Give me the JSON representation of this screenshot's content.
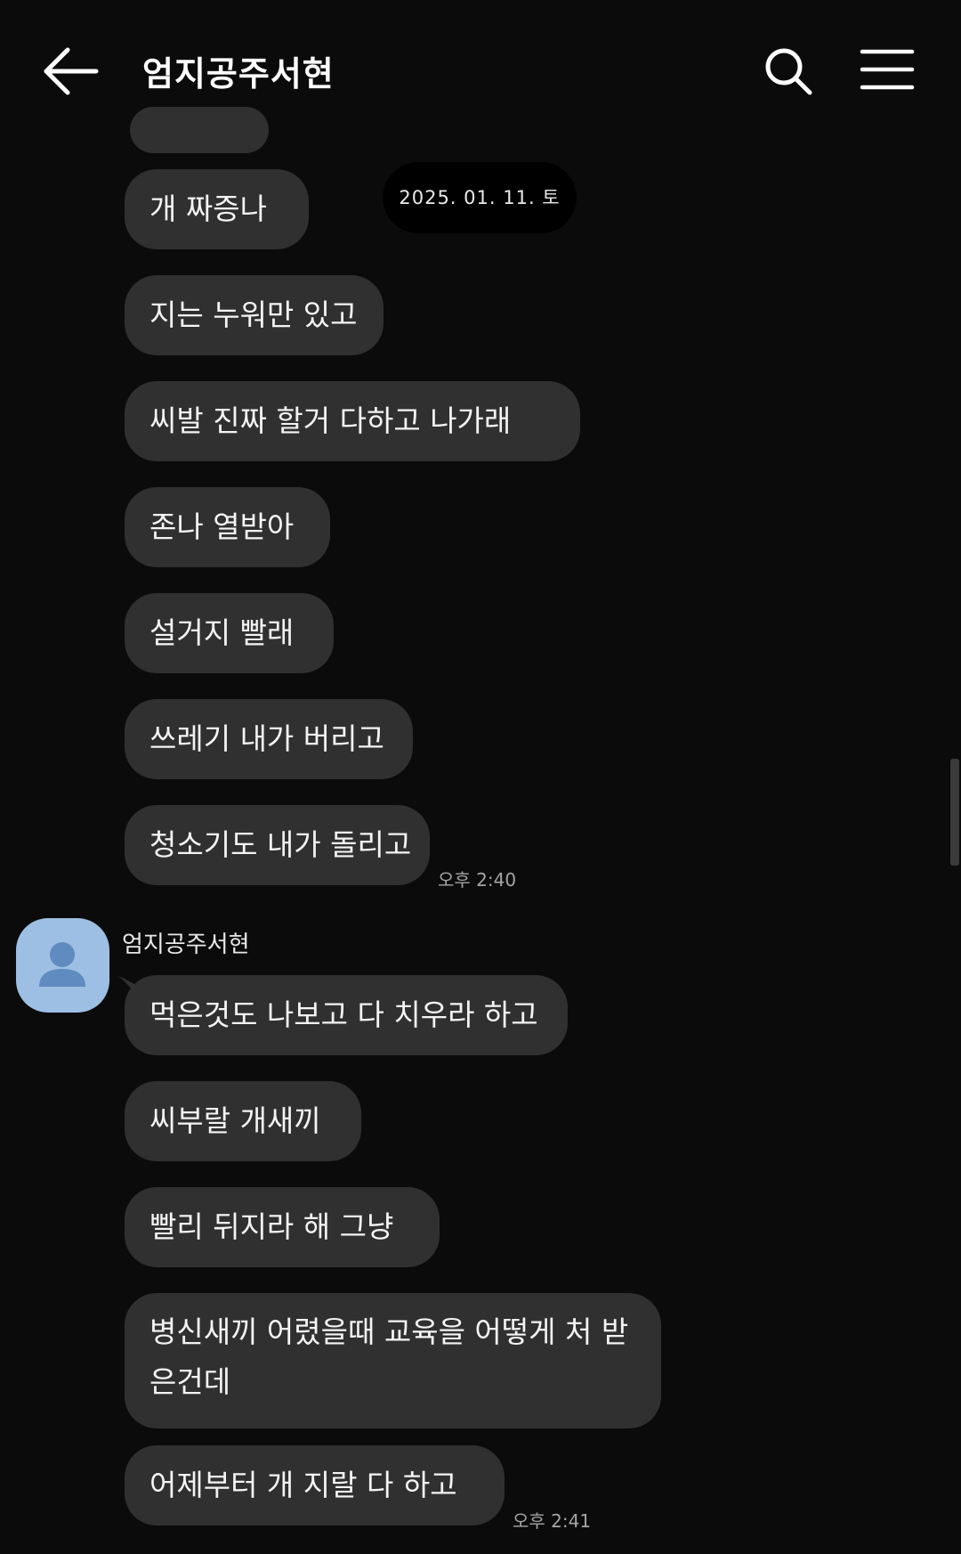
{
  "header": {
    "title": "엄지공주서현"
  },
  "date_separator": "2025. 01. 11. 토",
  "messages_group1": [
    "개 짜증나",
    "지는 누워만 있고",
    "씨발 진짜 할거 다하고 나가래",
    "존나 열받아",
    "설거지 빨래",
    "쓰레기 내가 버리고",
    "청소기도 내가 돌리고"
  ],
  "time1": "오후 2:40",
  "sender_name": "엄지공주서현",
  "messages_group2": [
    "먹은것도 나보고 다 치우라 하고",
    "씨부랄 개새끼",
    "빨리 뒤지라 해 그냥",
    "병신새끼 어렸을때 교육을 어떻게 처 받은건데",
    "어제부터 개 지랄 다 하고"
  ],
  "time2": "오후 2:41",
  "icons": [
    "back-arrow-icon",
    "search-icon",
    "menu-icon",
    "avatar-person-icon"
  ],
  "colors": {
    "background": "#0b0b0b",
    "bubble": "#303030",
    "avatar": "#9dbfe3",
    "avatar_icon": "#5f8bc0"
  }
}
